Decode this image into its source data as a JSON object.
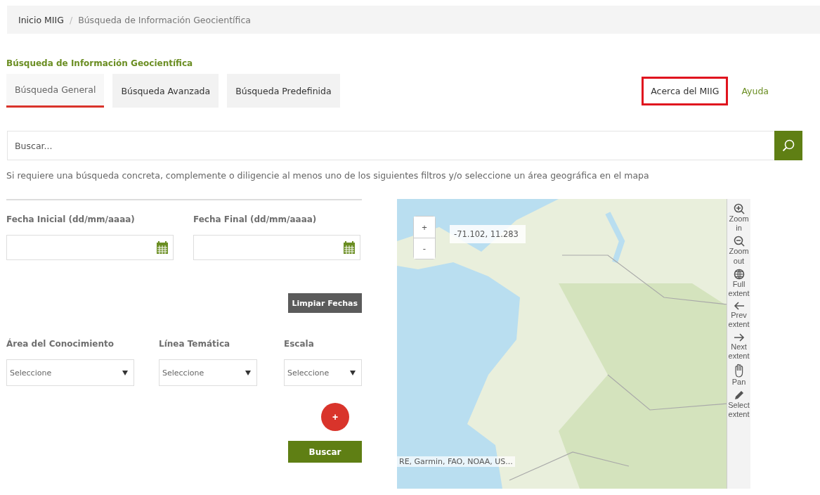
{
  "breadcrumb": [
    {
      "label": "Inicio MIIG",
      "current": false
    },
    {
      "label": "Búsqueda de Información Geocientífica",
      "current": true
    }
  ],
  "breadcrumb_separator": "/",
  "page_title": "Búsqueda de Información Geocientífica",
  "tabs": [
    {
      "label": "Búsqueda General",
      "selected": true
    },
    {
      "label": "Búsqueda Avanzada",
      "selected": false
    },
    {
      "label": "Búsqueda Predefinida",
      "selected": false
    }
  ],
  "links": [
    {
      "label": "Acerca del MIIG",
      "highlighted": true
    },
    {
      "label": "Ayuda",
      "highlighted": false
    }
  ],
  "search": {
    "placeholder": "Buscar..."
  },
  "hint": "Si requiere una búsqueda concreta, complemente o diligencie al menos uno de los siguientes filtros y/o seleccione un área geográfica en el mapa",
  "date_fields": [
    {
      "label": "Fecha Inicial (dd/mm/aaaa)"
    },
    {
      "label": "Fecha Final (dd/mm/aaaa)"
    }
  ],
  "clear_dates_button": "Limpiar Fechas",
  "selects": [
    {
      "label": "Área del Conocimiento",
      "value": "Seleccione"
    },
    {
      "label": "Línea Temática",
      "value": "Seleccione"
    },
    {
      "label": "Escala",
      "value": "Seleccione"
    }
  ],
  "add_button": "+",
  "search_button": "Buscar",
  "map": {
    "zoom_in": "+",
    "zoom_out": "-",
    "coordinates": "-71.102, 11.283",
    "attribution": "RE, Garmin, FAO, NOAA, US...",
    "tools": [
      {
        "kind": "zoom-in",
        "label": "Zoom in"
      },
      {
        "kind": "zoom-out",
        "label": "Zoom out"
      },
      {
        "kind": "full",
        "label": "Full extent"
      },
      {
        "kind": "prev",
        "label": "Prev extent"
      },
      {
        "kind": "next",
        "label": "Next extent"
      },
      {
        "kind": "pan",
        "label": "Pan"
      },
      {
        "kind": "select",
        "label": "Select extent"
      }
    ]
  }
}
